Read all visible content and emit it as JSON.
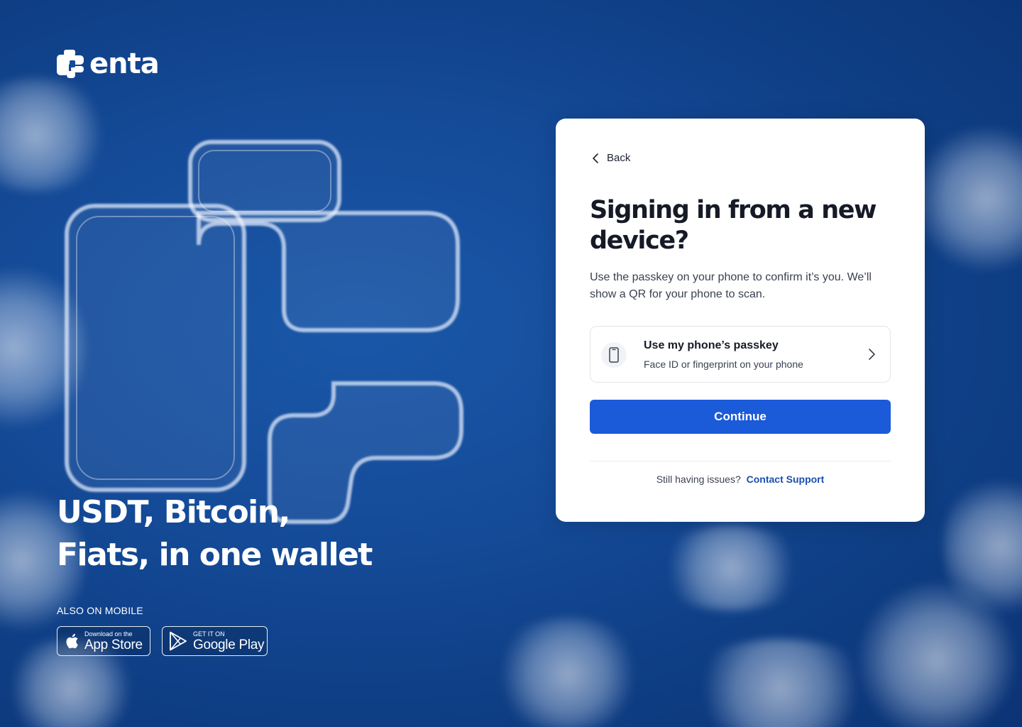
{
  "brand": {
    "name": "enta"
  },
  "hero": {
    "tagline_line1": "USDT, Bitcoin,",
    "tagline_line2": "Fiats, in one wallet",
    "also_on_mobile": "ALSO ON MOBILE"
  },
  "stores": {
    "apple": {
      "small": "Download on the",
      "big": "App Store",
      "icon": "apple-icon"
    },
    "google": {
      "small": "GET IT ON",
      "big": "Google Play",
      "icon": "google-play-icon"
    }
  },
  "card": {
    "back_label": "Back",
    "title": "Signing in from a new device?",
    "description": "Use the passkey on your phone to confirm it’s you. We’ll show a QR for your phone to scan.",
    "option": {
      "title": "Use my phone’s passkey",
      "subtitle": "Face ID or fingerprint on your phone",
      "icon": "phone-icon"
    },
    "continue_label": "Continue",
    "support_prompt": "Still having issues?",
    "support_link": "Contact Support"
  },
  "colors": {
    "background": "#154c9a",
    "primary_button": "#1b5ad8",
    "link": "#1a4fae"
  }
}
